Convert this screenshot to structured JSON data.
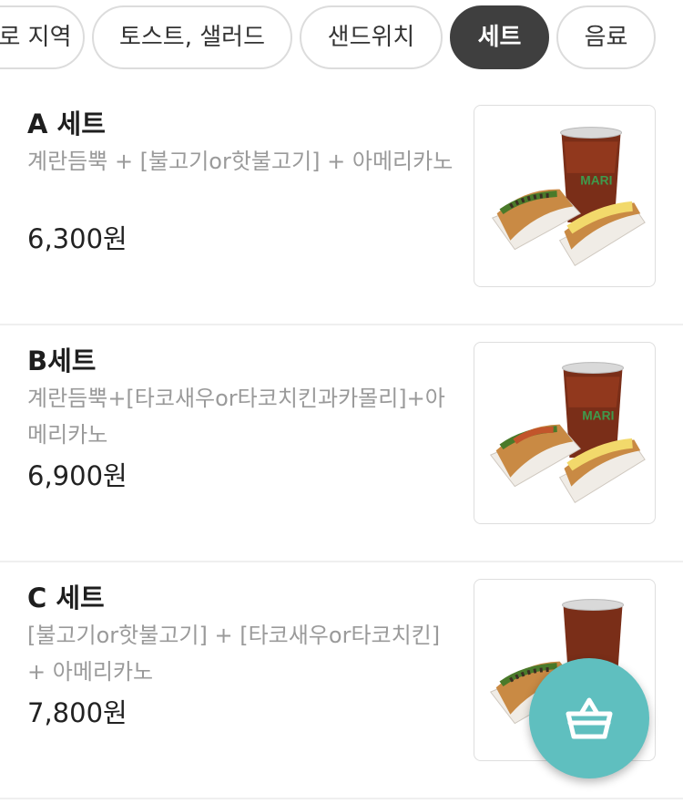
{
  "category_tabs": [
    {
      "label": "로 지역"
    },
    {
      "label": "토스트, 샐러드"
    },
    {
      "label": "샌드위치"
    },
    {
      "label": "세트",
      "active": true
    },
    {
      "label": "음료"
    }
  ],
  "menu_items": [
    {
      "name": "A 세트",
      "description": "계란듬뿍 + [불고기or핫불고기] + 아메리카노",
      "price": "6,300원",
      "image": "set-a-photo"
    },
    {
      "name": "B세트",
      "description": "계란듬뿍+[타코새우or타코치킨과카몰리]+아메리카노",
      "price": "6,900원",
      "image": "set-b-photo"
    },
    {
      "name": "C 세트",
      "description": "[불고기or핫불고기] + [타코새우or타코치킨] + 아메리카노",
      "price": "7,800원",
      "image": "set-c-photo"
    }
  ],
  "cart_button": {
    "icon": "basket-icon"
  },
  "colors": {
    "active_tab": "#3f3f3f",
    "fab": "#5fbfbf",
    "description": "#9a9a9a"
  }
}
